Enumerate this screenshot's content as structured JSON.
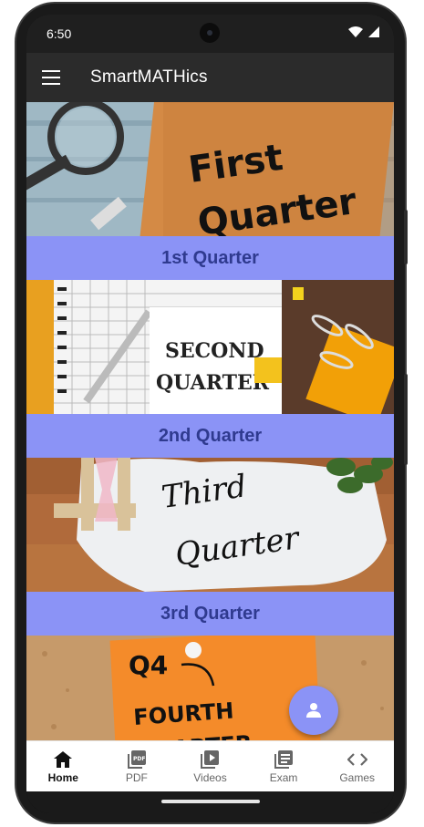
{
  "status": {
    "time": "6:50"
  },
  "app": {
    "title": "SmartMATHics"
  },
  "cards": [
    {
      "label": "1st Quarter",
      "image_text": [
        "First",
        "Quarter"
      ]
    },
    {
      "label": "2nd Quarter",
      "image_text": [
        "SECOND",
        "QUARTER"
      ]
    },
    {
      "label": "3rd Quarter",
      "image_text": [
        "Third",
        "Quarter"
      ]
    },
    {
      "label": "",
      "image_text": [
        "Q4",
        "FOURTH",
        "QUARTER"
      ]
    }
  ],
  "nav": [
    {
      "label": "Home",
      "icon": "home-icon",
      "active": true
    },
    {
      "label": "PDF",
      "icon": "pdf-icon"
    },
    {
      "label": "Videos",
      "icon": "video-library-icon"
    },
    {
      "label": "Exam",
      "icon": "exam-icon"
    },
    {
      "label": "Games",
      "icon": "code-icon"
    }
  ],
  "colors": {
    "accent": "#8b93f6",
    "label_text": "#2f3a8f",
    "appbar": "#2b2b2b"
  }
}
